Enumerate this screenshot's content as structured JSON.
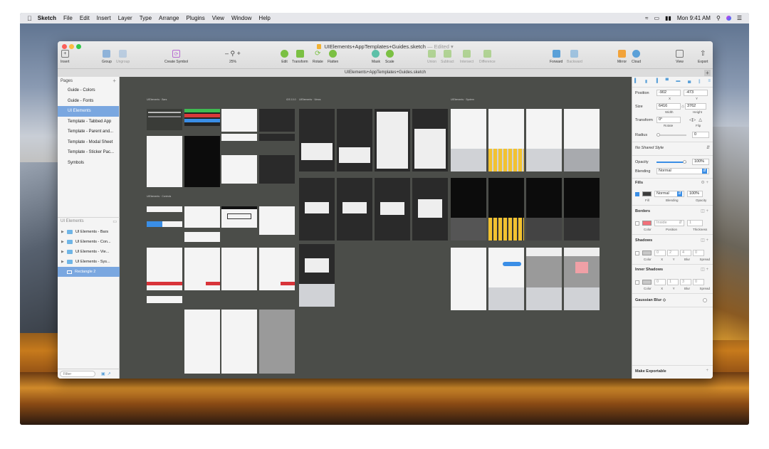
{
  "menubar": {
    "app": "Sketch",
    "items": [
      "File",
      "Edit",
      "Insert",
      "Layer",
      "Type",
      "Arrange",
      "Plugins",
      "View",
      "Window",
      "Help"
    ],
    "clock": "Mon 9:41 AM"
  },
  "window": {
    "doc_title": "UIElements+AppTemplates+Guides.sketch",
    "edited": "— Edited ▾",
    "tab_label": "UIElements+AppTemplates+Guides.sketch"
  },
  "toolbar": {
    "insert": "Insert",
    "group": "Group",
    "ungroup": "Ungroup",
    "create_symbol": "Create Symbol",
    "zoom_minus": "–",
    "zoom_plus": "+",
    "zoom_level": "25%",
    "edit": "Edit",
    "transform": "Transform",
    "rotate": "Rotate",
    "flatten": "Flatten",
    "mask": "Mask",
    "scale": "Scale",
    "union": "Union",
    "subtract": "Subtract",
    "intersect": "Intersect",
    "difference": "Difference",
    "forward": "Forward",
    "backward": "Backward",
    "mirror": "Mirror",
    "cloud": "Cloud",
    "view": "View",
    "export": "Export"
  },
  "pages": {
    "header": "Pages",
    "add": "+",
    "items": [
      "Guide - Colors",
      "Guide - Fonts",
      "UI Elements",
      "Template - Tabbed App",
      "Template - Parent and...",
      "Template - Modal Sheet",
      "Template - Sticker Pac...",
      "Symbols"
    ],
    "selected_index": 2
  },
  "layers": {
    "header": "UI Elements",
    "items": [
      "UI Elements - Bars",
      "UI Elements - Con...",
      "UI Elements - Vie...",
      "UI Elements - Sys..."
    ],
    "selected": "Rectangle 2"
  },
  "filter": {
    "placeholder": "Filter"
  },
  "canvas": {
    "labels": {
      "bars": "UIElements · Bars",
      "views": "UIElements · Views",
      "controls": "UIElements · Controls",
      "system": "UIElements · System",
      "ios": "iOS 10.0"
    }
  },
  "inspector": {
    "position_label": "Position",
    "position_x": "-902",
    "position_y": "-473",
    "x_label": "X",
    "y_label": "Y",
    "size_label": "Size",
    "width": "6416",
    "height": "3762",
    "width_label": "Width",
    "height_label": "Height",
    "transform_label": "Transform",
    "rotate_value": "0°",
    "rotate_label": "Rotate",
    "flip_label": "Flip",
    "radius_label": "Radius",
    "radius_value": "0",
    "shared_style": "No Shared Style",
    "opacity_label": "Opacity",
    "opacity_value": "100%",
    "blending_label": "Blending",
    "blending_value": "Normal",
    "fills": {
      "title": "Fills",
      "blending": "Normal",
      "opacity": "100%",
      "fill_label": "Fill",
      "blending_label": "Blending",
      "opacity_label": "Opacity",
      "color": "#3c3c3c"
    },
    "borders": {
      "title": "Borders",
      "position": "Inside",
      "thickness": "1",
      "color_label": "Color",
      "position_label": "Position",
      "thickness_label": "Thickness",
      "color": "#f2707a"
    },
    "shadows": {
      "title": "Shadows",
      "x": "0",
      "y": "2",
      "blur": "4",
      "spread": "0",
      "labels": [
        "Color",
        "X",
        "Y",
        "Blur",
        "Spread"
      ]
    },
    "inner_shadows": {
      "title": "Inner Shadows",
      "x": "0",
      "y": "1",
      "blur": "3",
      "spread": "0",
      "labels": [
        "Color",
        "X",
        "Y",
        "Blur",
        "Spread"
      ]
    },
    "gaussian_blur": "Gaussian Blur ◇",
    "make_exportable": "Make Exportable"
  },
  "colors": {
    "accent": "#3a8ee6",
    "selection": "#7aa7e0",
    "canvas": "#4b4d49"
  }
}
